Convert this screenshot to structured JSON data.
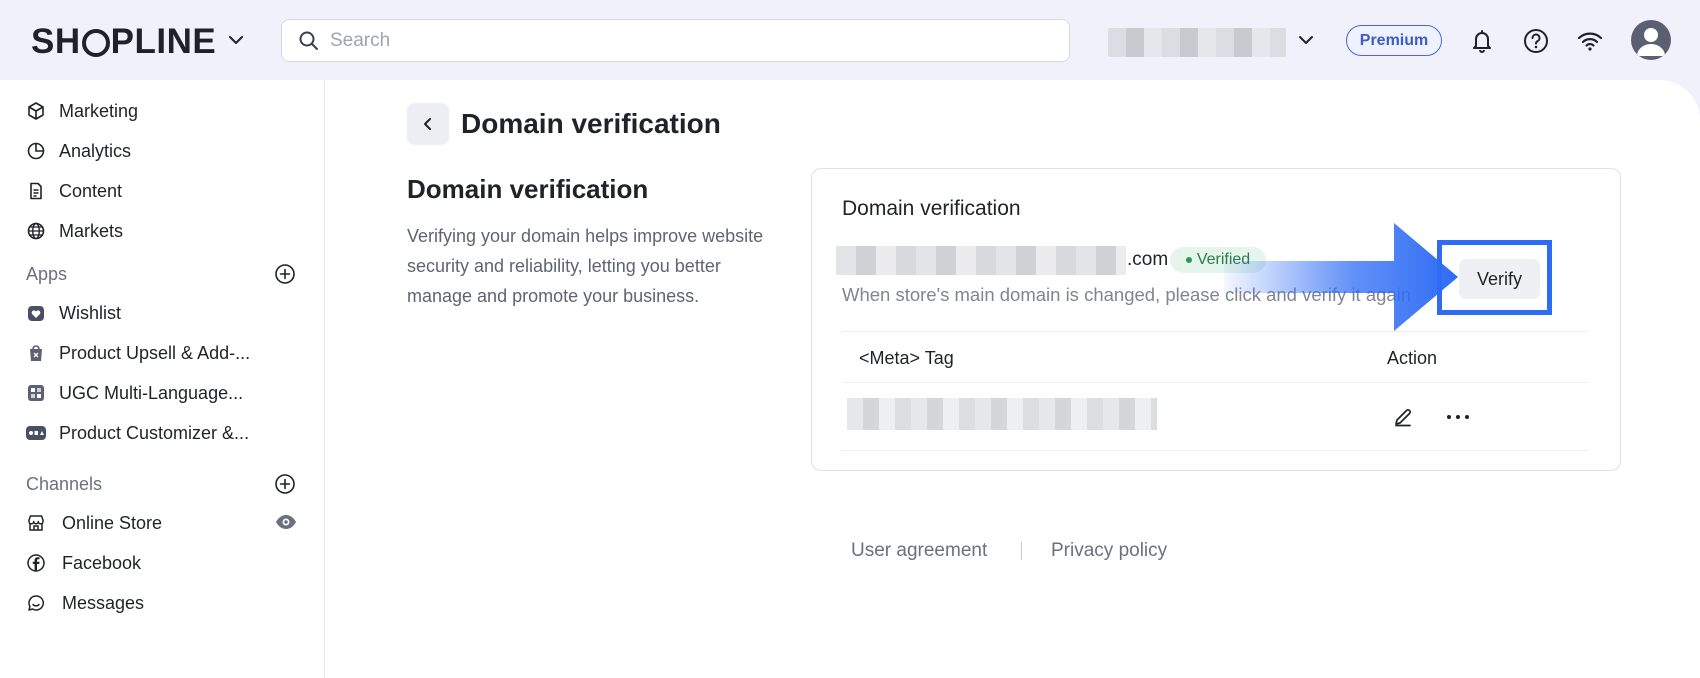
{
  "brand": {
    "logo_pre": "SH",
    "logo_post": "PLINE"
  },
  "search": {
    "placeholder": "Search"
  },
  "header": {
    "premium_label": "Premium"
  },
  "sidebar": {
    "items_top": [
      "Marketing",
      "Analytics",
      "Content",
      "Markets"
    ],
    "apps_label": "Apps",
    "apps": [
      "Wishlist",
      "Product Upsell & Add-...",
      "UGC Multi-Language...",
      "Product Customizer &..."
    ],
    "channels_label": "Channels",
    "channels": [
      "Online Store",
      "Facebook",
      "Messages"
    ]
  },
  "page": {
    "title": "Domain verification",
    "section_title": "Domain verification",
    "section_desc": "Verifying your domain helps improve website security and reliability, letting you better manage and promote your business."
  },
  "card": {
    "title": "Domain verification",
    "domain_suffix": ".com",
    "status": "Verified",
    "hint": "When store's main domain is changed, please click and verify it again",
    "verify_label": "Verify",
    "col_meta": "<Meta> Tag",
    "col_action": "Action"
  },
  "footer": {
    "user_agreement": "User agreement",
    "privacy_policy": "Privacy policy"
  },
  "colors": {
    "accent": "#2e6cf5",
    "premium": "#3f5bc9",
    "verified_bg": "#e5f5ec"
  }
}
